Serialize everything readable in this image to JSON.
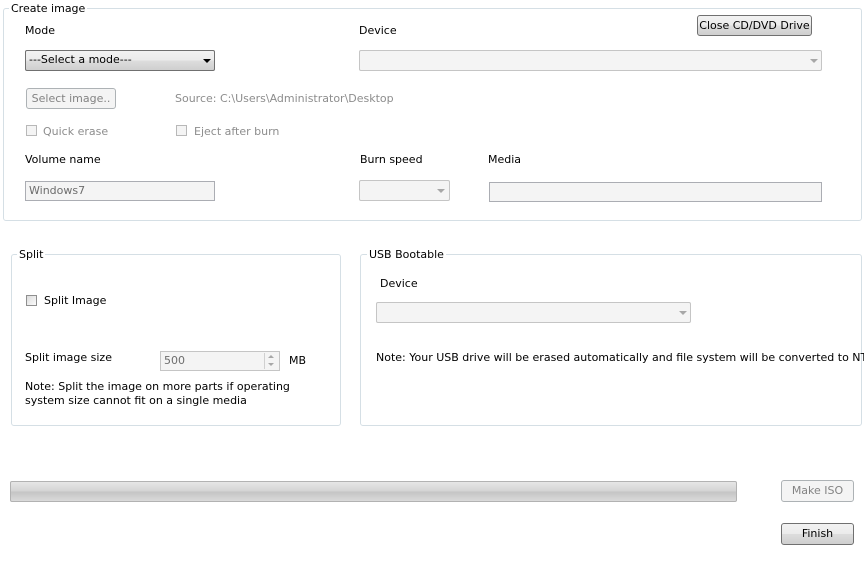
{
  "create_image": {
    "legend": "Create image",
    "mode_label": "Mode",
    "mode_value": "---Select a mode---",
    "device_label": "Device",
    "close_drive_button": "Close CD/DVD Drive",
    "select_image_button": "Select image..",
    "source_text": "Source: C:\\Users\\Administrator\\Desktop",
    "quick_erase_label": "Quick erase",
    "eject_label": "Eject after burn",
    "volume_name_label": "Volume name",
    "volume_name_value": "Windows7",
    "burn_speed_label": "Burn speed",
    "media_label": "Media"
  },
  "split": {
    "legend": "Split",
    "split_image_label": "Split Image",
    "size_label": "Split image size",
    "size_value": "500",
    "unit": "MB",
    "note": "Note: Split the image on more parts if operating system size cannot fit on a single media"
  },
  "usb": {
    "legend": "USB Bootable",
    "device_label": "Device",
    "note": "Note: Your USB drive will be erased automatically and file system will be converted to NTFS."
  },
  "footer": {
    "progress": 0,
    "make_iso_button": "Make ISO",
    "finish_button": "Finish"
  }
}
